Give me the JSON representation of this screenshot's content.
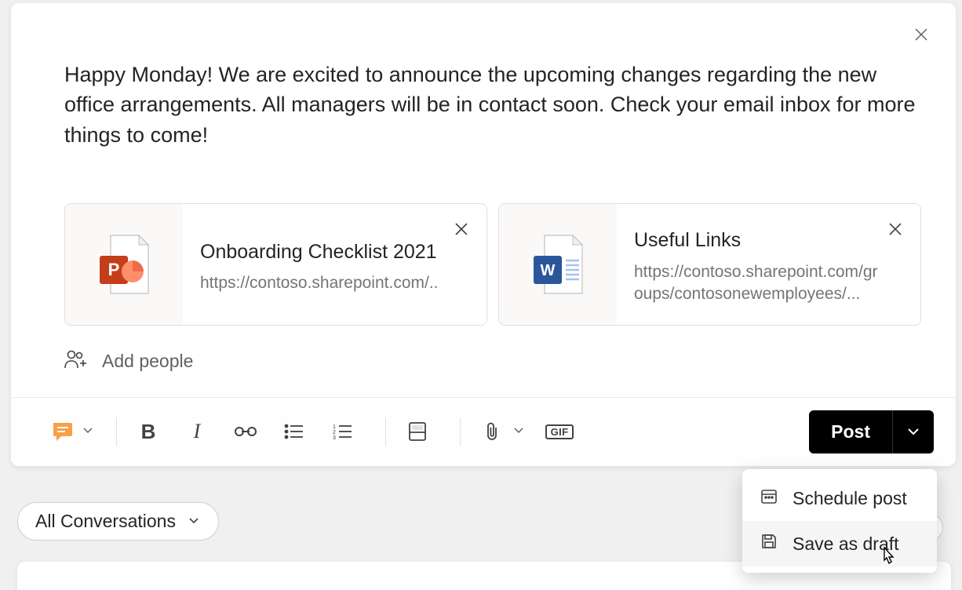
{
  "compose": {
    "message": "Happy Monday! We are excited to announce the upcoming changes regarding the new office arrangements. All managers will be in contact soon. Check your email inbox for more things to come!",
    "add_people_label": "Add people"
  },
  "attachments": [
    {
      "title": "Onboarding Checklist 2021",
      "url": "https://contoso.sharepoint.com/..",
      "type": "powerpoint"
    },
    {
      "title": "Useful Links",
      "url": "https://contoso.sharepoint.com/groups/contosonewemployees/...",
      "type": "word"
    }
  ],
  "toolbar": {
    "post_label": "Post",
    "gif_label": "GIF"
  },
  "dropdown": {
    "schedule_label": "Schedule post",
    "save_draft_label": "Save as draft"
  },
  "filter": {
    "label": "All Conversations"
  }
}
